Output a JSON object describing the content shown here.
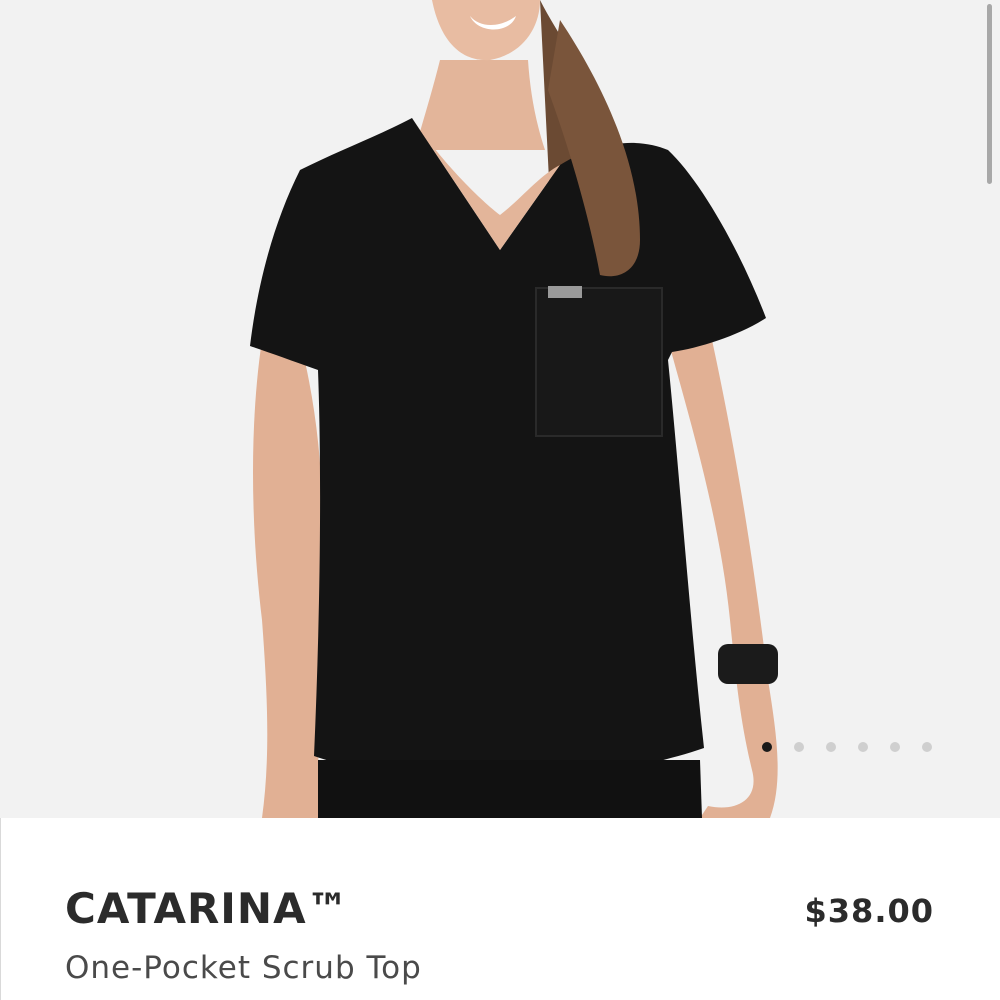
{
  "gallery": {
    "image_alt": "Model wearing black one-pocket scrub top",
    "dot_count": 6,
    "active_index": 0,
    "colors": {
      "background": "#f2f2f2",
      "garment": "#141414",
      "dot_active": "#1a1a1a",
      "dot_inactive": "#cfcfcf"
    }
  },
  "product": {
    "name": "CATARINA™",
    "subtitle": "One-Pocket Scrub Top",
    "price": "$38.00"
  }
}
